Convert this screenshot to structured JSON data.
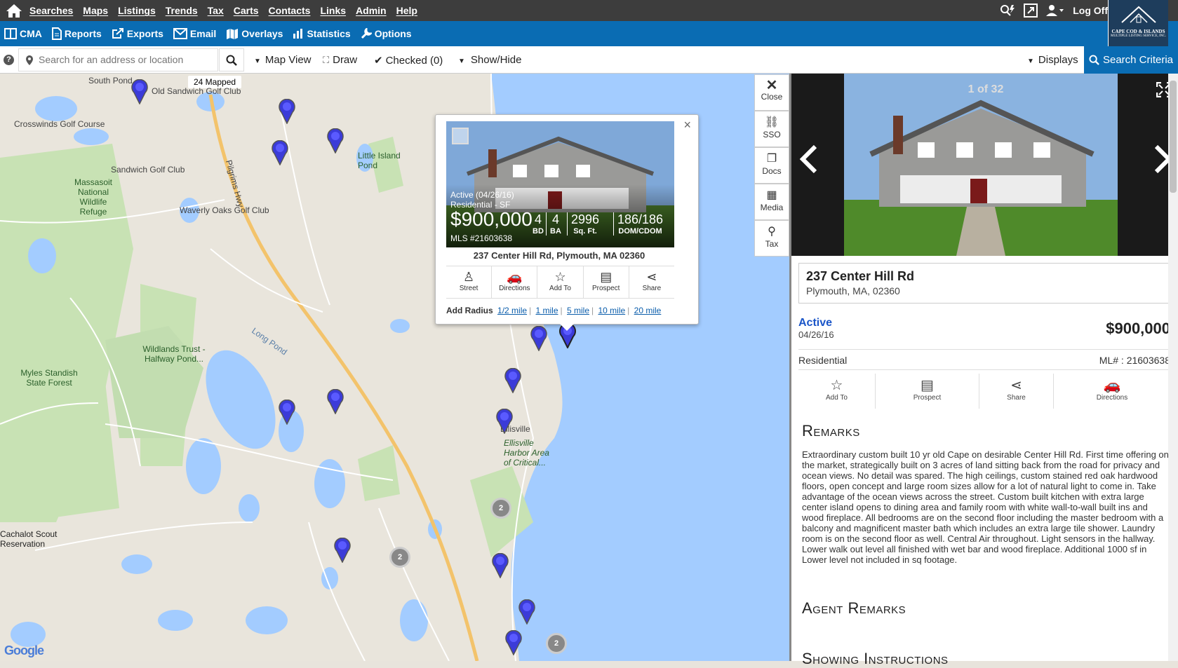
{
  "topnav": {
    "menu": [
      "Searches",
      "Maps",
      "Listings",
      "Trends",
      "Tax",
      "Carts",
      "Contacts",
      "Links",
      "Admin",
      "Help"
    ],
    "logoff": "Log Off"
  },
  "logo": {
    "line1": "CAPE COD & ISLANDS",
    "line2": "MULTIPLE LISTING SERVICE, INC."
  },
  "toolbar": [
    "CMA",
    "Reports",
    "Exports",
    "Email",
    "Overlays",
    "Statistics",
    "Options"
  ],
  "search": {
    "placeholder": "Search for an address or location",
    "map_view": "Map View",
    "draw": "Draw",
    "checked": "Checked (0)",
    "show_hide": "Show/Hide",
    "displays": "Displays",
    "criteria": "Search Criteria"
  },
  "map": {
    "mapped": "24 Mapped",
    "labels": {
      "south_pond": "South Pond",
      "old_sandwich": "Old Sandwich Golf Club",
      "crosswinds": "Crosswinds Golf Course",
      "little_island": "Little Island Pond",
      "sandwich_gc": "Sandwich Golf Club",
      "massasoit": "Massasoit National Wildlife Refuge",
      "waverly": "Waverly Oaks Golf Club",
      "wildlands": "Wildlands Trust - Halfway Pond...",
      "myles": "Myles Standish State Forest",
      "long_pond": "Long Pond",
      "ellisville": "Ellisville",
      "ellisville_harbor": "Ellisville Harbor Area of Critical...",
      "cachalot": "Cachalot Scout Reservation",
      "pilgrims": "Pilgrims Hwy",
      "google": "Google"
    },
    "clusters": [
      "2",
      "2",
      "2"
    ]
  },
  "popup": {
    "status": "Active (04/26/16)",
    "type": "Residential - SF",
    "price": "$900,000",
    "mls": "MLS #21603638",
    "beds": "4",
    "beds_label": "BD",
    "baths": "4",
    "baths_label": "BA",
    "sqft": "2996",
    "sqft_label": "Sq. Ft.",
    "dom": "186/186",
    "dom_label": "DOM/CDOM",
    "address": "237 Center Hill Rd, Plymouth, MA 02360",
    "actions": [
      "Street",
      "Directions",
      "Add To",
      "Prospect",
      "Share"
    ],
    "radius_label": "Add Radius",
    "radius": [
      "1/2 mile",
      "1 mile",
      "5 mile",
      "10 mile",
      "20 mile"
    ]
  },
  "tools": [
    "Close",
    "SSO",
    "Docs",
    "Media",
    "Tax"
  ],
  "detail": {
    "counter": "1 of 32",
    "street": "237 Center Hill Rd",
    "city": "Plymouth, MA, 02360",
    "status": "Active",
    "date": "04/26/16",
    "price": "$900,000",
    "type": "Residential",
    "ml": "ML# : 21603638",
    "actions": [
      "Add To",
      "Prospect",
      "Share",
      "Directions"
    ],
    "remarks_title": "Remarks",
    "remarks": "Extraordinary custom built 10 yr old Cape on desirable Center Hill Rd. First time offering on the market, strategically built on 3 acres of land sitting back from the road for privacy and ocean views. No detail was spared. The high ceilings, custom stained red oak hardwood floors, open concept and large room sizes allow for a lot of natural light to come in. Take advantage of the ocean views across the street. Custom built kitchen with extra large center island opens to dining area and family room with white wall-to-wall built ins and wood fireplace. All bedrooms are on the second floor including the master bedroom with a balcony and magnificent master bath which includes an extra large tile shower. Laundry room is on the second floor as well. Central Air throughout. Light sensors in the hallway. Lower walk out level all finished with wet bar and wood fireplace. Additional 1000 sf in Lower level not included in sq footage.",
    "agent_remarks_title": "Agent Remarks",
    "showing_title": "Showing Instructions"
  }
}
